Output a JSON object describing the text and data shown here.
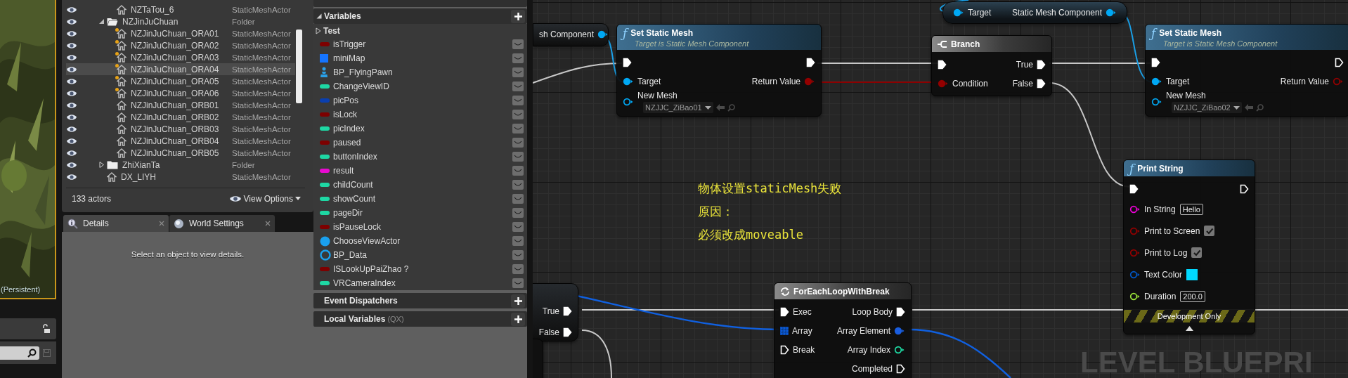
{
  "viewport": {
    "level_label": "(Persistent)"
  },
  "outliner": {
    "tree": [
      {
        "children": [
          {
            "label": "NZTaTou_6",
            "type": "StaticMeshActor",
            "kind": "actor",
            "flagged": false,
            "selected": false
          }
        ]
      },
      {
        "label": "NZJinJuChuan",
        "type": "Folder",
        "kind": "folder",
        "expanded": true,
        "selected": false,
        "children": [
          {
            "label": "NZJinJuChuan_ORA01",
            "type": "StaticMeshActor",
            "kind": "actor",
            "flagged": true,
            "selected": false
          },
          {
            "label": "NZJinJuChuan_ORA02",
            "type": "StaticMeshActor",
            "kind": "actor",
            "flagged": true,
            "selected": false
          },
          {
            "label": "NZJinJuChuan_ORA03",
            "type": "StaticMeshActor",
            "kind": "actor",
            "flagged": true,
            "selected": false
          },
          {
            "label": "NZJinJuChuan_ORA04",
            "type": "StaticMeshActor",
            "kind": "actor",
            "flagged": true,
            "selected": true
          },
          {
            "label": "NZJinJuChuan_ORA05",
            "type": "StaticMeshActor",
            "kind": "actor",
            "flagged": true,
            "selected": false
          },
          {
            "label": "NZJinJuChuan_ORA06",
            "type": "StaticMeshActor",
            "kind": "actor",
            "flagged": true,
            "selected": false
          },
          {
            "label": "NZJinJuChuan_ORB01",
            "type": "StaticMeshActor",
            "kind": "actor",
            "flagged": false,
            "selected": false
          },
          {
            "label": "NZJinJuChuan_ORB02",
            "type": "StaticMeshActor",
            "kind": "actor",
            "flagged": false,
            "selected": false
          },
          {
            "label": "NZJinJuChuan_ORB03",
            "type": "StaticMeshActor",
            "kind": "actor",
            "flagged": false,
            "selected": false
          },
          {
            "label": "NZJinJuChuan_ORB04",
            "type": "StaticMeshActor",
            "kind": "actor",
            "flagged": false,
            "selected": false
          },
          {
            "label": "NZJinJuChuan_ORB05",
            "type": "StaticMeshActor",
            "kind": "actor",
            "flagged": false,
            "selected": false
          }
        ]
      },
      {
        "label": "ZhiXianTa",
        "type": "Folder",
        "kind": "folder",
        "expanded": false,
        "selected": false
      },
      {
        "label": "DX_LIYH",
        "type": "StaticMeshActor",
        "kind": "actor",
        "flagged": false,
        "selected": false
      }
    ],
    "count": "133 actors",
    "view_options": "View Options"
  },
  "details": {
    "tabs": [
      {
        "label": "Details",
        "selected": true
      },
      {
        "label": "World Settings",
        "selected": false
      }
    ],
    "empty_message": "Select an object to view details."
  },
  "my_blueprint": {
    "variables": {
      "title": "Variables",
      "expanded": true,
      "category": {
        "label": "Test",
        "expanded": false
      },
      "items": [
        {
          "name": "isTrigger",
          "kind": "pill",
          "color": "#7d0000"
        },
        {
          "name": "miniMap",
          "kind": "square",
          "color": "#1574ff"
        },
        {
          "name": "BP_FlyingPawn",
          "kind": "pawn",
          "color": "#2aa0e8"
        },
        {
          "name": "ChangeViewID",
          "kind": "pill",
          "color": "#1ed8a4"
        },
        {
          "name": "picPos",
          "kind": "pill",
          "color": "#0a3fb0"
        },
        {
          "name": "isLock",
          "kind": "pill",
          "color": "#7d0000"
        },
        {
          "name": "picIndex",
          "kind": "pill",
          "color": "#1ed8a4"
        },
        {
          "name": "paused",
          "kind": "pill",
          "color": "#7d0000"
        },
        {
          "name": "buttonIndex",
          "kind": "pill",
          "color": "#1ed8a4"
        },
        {
          "name": "result",
          "kind": "pill",
          "color": "#e80ad0"
        },
        {
          "name": "childCount",
          "kind": "pill",
          "color": "#1ed8a4"
        },
        {
          "name": "showCount",
          "kind": "pill",
          "color": "#1ed8a4"
        },
        {
          "name": "pageDir",
          "kind": "pill",
          "color": "#1ed8a4"
        },
        {
          "name": "isPauseLock",
          "kind": "pill",
          "color": "#7d0000"
        },
        {
          "name": "ChooseViewActor",
          "kind": "sphere",
          "color": "#1aa0ee"
        },
        {
          "name": "BP_Data",
          "kind": "ring",
          "color": "#1aa0ee"
        },
        {
          "name": "ISLookUpPaiZhao ?",
          "kind": "pill",
          "color": "#7d0000"
        },
        {
          "name": "VRCameraIndex",
          "kind": "pill",
          "color": "#1ed8a4"
        }
      ]
    },
    "sections": [
      {
        "title": "Event Dispatchers"
      },
      {
        "title": "Local Variables",
        "suffix": "(QX)"
      }
    ]
  },
  "graph": {
    "nodes": [
      {
        "kind": "partial",
        "rows": [
          {
            "out": {
              "label": "sh Component",
              "kind": "object",
              "connected": true
            }
          }
        ]
      },
      {
        "kind": "function",
        "glyph": "ƒ",
        "title": "Set Static Mesh",
        "subtitle": "Target is Static Mesh Component",
        "rows": [
          {
            "in": {
              "kind": "exec",
              "connected": true
            },
            "out": {
              "kind": "exec",
              "connected": true
            }
          },
          {
            "in": {
              "label": "Target",
              "kind": "object",
              "connected": true
            },
            "out": {
              "label": "Return Value",
              "kind": "bool",
              "connected": true
            }
          },
          {
            "in": {
              "label": "New Mesh",
              "kind": "object",
              "connected": false,
              "asset": "NZJJC_ZiBao01"
            }
          }
        ]
      },
      {
        "kind": "pure",
        "rows": [
          {
            "in": {
              "label": "Target",
              "kind": "object",
              "connected": true
            },
            "out": {
              "label": "Static Mesh Component",
              "kind": "object",
              "connected": true
            }
          }
        ]
      },
      {
        "kind": "branch",
        "title": "Branch",
        "rows": [
          {
            "in": {
              "kind": "exec",
              "connected": true
            },
            "out": {
              "label": "True",
              "kind": "exec",
              "connected": true
            }
          },
          {
            "in": {
              "label": "Condition",
              "kind": "bool",
              "connected": true
            },
            "out": {
              "label": "False",
              "kind": "exec",
              "connected": true
            }
          }
        ]
      },
      {
        "kind": "function",
        "glyph": "ƒ",
        "title": "Set Static Mesh",
        "subtitle": "Target is Static Mesh Component",
        "rows": [
          {
            "in": {
              "kind": "exec",
              "connected": true
            },
            "out": {
              "kind": "exec",
              "connected": false
            }
          },
          {
            "in": {
              "label": "Target",
              "kind": "object",
              "connected": true
            },
            "out": {
              "label": "Return Value",
              "kind": "bool",
              "connected": false
            }
          },
          {
            "in": {
              "label": "New Mesh",
              "kind": "object",
              "connected": false,
              "asset": "NZJJC_ZiBao02"
            }
          }
        ]
      },
      {
        "kind": "function",
        "glyph": "ƒ",
        "title": "Print String",
        "rows": [
          {
            "in": {
              "kind": "exec",
              "connected": true
            },
            "out": {
              "kind": "exec",
              "connected": false
            }
          },
          {
            "in": {
              "label": "In String",
              "kind": "string",
              "connected": false,
              "value": "Hello"
            }
          },
          {
            "in": {
              "label": "Print to Screen",
              "kind": "bool",
              "connected": false,
              "checked": true
            }
          },
          {
            "in": {
              "label": "Print to Log",
              "kind": "bool",
              "connected": false,
              "checked": true
            }
          },
          {
            "in": {
              "label": "Text Color",
              "kind": "color",
              "connected": false,
              "color": "#00d8ff"
            }
          },
          {
            "in": {
              "label": "Duration",
              "kind": "float",
              "connected": false,
              "value": "200.0"
            }
          }
        ],
        "footer": "Development Only",
        "advanced_expanded": true
      },
      {
        "kind": "loop",
        "title": "ForEachLoopWithBreak",
        "rows": [
          {
            "in": {
              "label": "Exec",
              "kind": "exec",
              "connected": true
            },
            "out": {
              "label": "Loop Body",
              "kind": "exec",
              "connected": true
            }
          },
          {
            "in": {
              "label": "Array",
              "kind": "array",
              "connected": true
            },
            "out": {
              "label": "Array Element",
              "kind": "element",
              "connected": true
            }
          },
          {
            "in": {
              "label": "Break",
              "kind": "exec",
              "connected": false
            },
            "out": {
              "label": "Array Index",
              "kind": "int",
              "connected": false
            }
          },
          {
            "out": {
              "label": "Completed",
              "kind": "exec",
              "connected": false
            }
          }
        ]
      },
      {
        "kind": "partial",
        "rows": [
          {
            "out": {
              "label": "True",
              "kind": "exec",
              "connected": true
            }
          },
          {
            "out": {
              "label": "False",
              "kind": "exec",
              "connected": true
            }
          }
        ]
      },
      {
        "kind": "stub"
      }
    ],
    "comment_lines": [
      "物体设置staticMesh失败",
      "原因：",
      "必须改成moveable"
    ],
    "watermark": "LEVEL BLUEPRI"
  }
}
